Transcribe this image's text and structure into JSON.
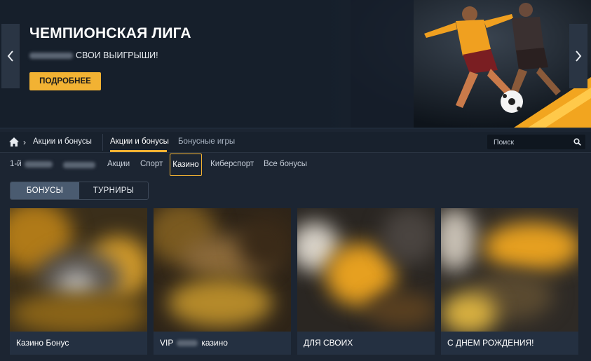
{
  "banner": {
    "title": "ЧЕМПИОНСКАЯ ЛИГА",
    "subtitle_visible": "СВОИ ВЫИГРЫШИ!",
    "button_label": "ПОДРОБНЕЕ",
    "accent_color": "#f2b233"
  },
  "nav": {
    "breadcrumb": "Акции и бонусы",
    "tabs": [
      {
        "label": "Акции и бонусы",
        "active": true
      },
      {
        "label": "Бонусные игры",
        "active": false
      }
    ],
    "search_placeholder": "Поиск"
  },
  "categories": {
    "first_prefix": "1-й",
    "items": [
      "Акции",
      "Спорт",
      "Казино",
      "Киберспорт",
      "Все бонусы"
    ],
    "active": "Казино"
  },
  "toggle": {
    "options": [
      "БОНУСЫ",
      "ТУРНИРЫ"
    ],
    "active": "БОНУСЫ"
  },
  "cards": [
    {
      "label_before": "Казино Бонус",
      "label_after": ""
    },
    {
      "label_before": "VIP",
      "label_after": "казино"
    },
    {
      "label_before": "ДЛЯ СВОИХ",
      "label_after": ""
    },
    {
      "label_before": "С ДНЕМ РОЖДЕНИЯ!",
      "label_after": ""
    }
  ],
  "icons": [
    "chevron-left-icon",
    "chevron-right-icon",
    "home-icon",
    "chevron-right-icon",
    "search-icon"
  ]
}
